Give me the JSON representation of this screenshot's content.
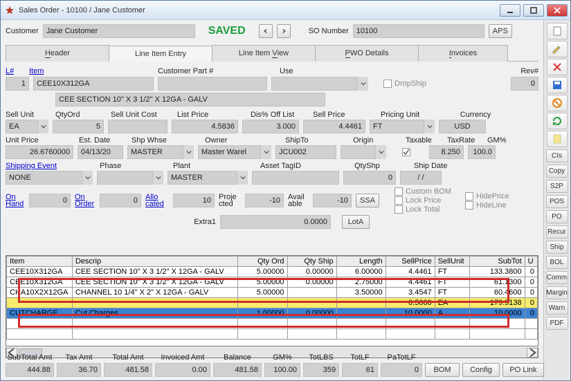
{
  "window_title": "Sales Order - 10100 / Jane Customer",
  "top": {
    "customer_label": "Customer",
    "customer_value": "Jane Customer",
    "status": "SAVED",
    "so_label": "SO Number",
    "so_value": "10100",
    "aps": "APS"
  },
  "tabs": {
    "header": "Header",
    "entry": "Line Item Entry",
    "view": "Line Item View",
    "pwo": "PWO Details",
    "invoices": "Invoices",
    "header_u": "H",
    "view_u": "V",
    "pwo_u": "P",
    "inv_u": "I"
  },
  "li": {
    "lnum_lbl": "L#",
    "item_lbl": "Item",
    "cpart_lbl": "Customer Part #",
    "use_lbl": "Use",
    "rev_lbl": "Rev#",
    "lnum": "1",
    "item": "CEE10X312GA",
    "cpart": "",
    "use": "",
    "rev": "0",
    "dropship": "DropShip",
    "desc": "CEE SECTION  10\" X 3 1/2\" X 12GA - GALV",
    "sellunit_lbl": "Sell Unit",
    "qtyord_lbl": "QtyOrd",
    "suc_lbl": "Sell Unit Cost",
    "list_lbl": "List Price",
    "disc_lbl": "Dis% Off List",
    "sellprice_lbl": "Sell Price",
    "punit_lbl": "Pricing Unit",
    "curr_lbl": "Currency",
    "sellunit": "EA",
    "qtyord": "5",
    "suc": "",
    "list": "4.5836",
    "disc": "3.000",
    "sellprice": "4.4461",
    "punit": "FT",
    "curr": "USD",
    "uprice_lbl": "Unit Price",
    "edate_lbl": "Est. Date",
    "whse_lbl": "Shp Whse",
    "owner_lbl": "Owner",
    "shipto_lbl": "ShipTo",
    "origin_lbl": "Origin",
    "tax_lbl": "Taxable",
    "rate_lbl": "TaxRate",
    "gm_lbl": "GM%",
    "uprice": "26.6760000",
    "edate": "04/13/20",
    "whse": "MASTER",
    "owner": "Master Warel",
    "shipto": "JCU002",
    "origin": "",
    "rate": "8.250",
    "gm": "100.0",
    "shevent_lbl": "Shipping Event",
    "phase_lbl": "Phase",
    "plant_lbl": "Plant",
    "asset_lbl": "Asset TagID",
    "qtyshp_lbl": "QtyShp",
    "shipdate_lbl": "Ship Date",
    "shevent": "NONE",
    "phase": "",
    "plant": "MASTER",
    "asset": "",
    "qtyshp": "0",
    "shipdate": "/  /",
    "onhand_lbl": "On Hand",
    "onhand": "0",
    "onorder_lbl": "On Order",
    "onorder": "0",
    "alloc_lbl": "Allo cated",
    "alloc": "10",
    "proj_lbl": "Proje cted",
    "proj": "-10",
    "avail_lbl": "Avail able",
    "avail": "-10",
    "ssa": "SSA",
    "custombom": "Custom BOM",
    "hideprice": "HidePrice",
    "lockprice": "Lock Price",
    "hideline": "HideLine",
    "locktotal": "Lock Total",
    "extra_lbl": "Extra1",
    "extra": "0.0000",
    "lota": "LotA"
  },
  "table": {
    "cols": {
      "item": "Item",
      "desc": "Descrip",
      "qord": "Qty Ord",
      "qship": "Qty Ship",
      "len": "Length",
      "sp": "SellPrice",
      "su": "SellUnit",
      "sub": "SubTot",
      "u": "U"
    },
    "rows": [
      {
        "item": "CEE10X312GA",
        "desc": "CEE SECTION  10\" X 3 1/2\" X 12GA - GALV",
        "qord": "5.00000",
        "qship": "0.00000",
        "len": "6.00000",
        "sp": "4.4461",
        "su": "FT",
        "sub": "133.3800",
        "u": "0"
      },
      {
        "item": "CEE10X312GA",
        "desc": "CEE SECTION  10\" X 3 1/2\" X 12GA - GALV",
        "qord": "5.00000",
        "qship": "0.00000",
        "len": "2.75000",
        "sp": "4.4461",
        "su": "FT",
        "sub": "61.1300",
        "u": "0"
      },
      {
        "item": "CHA10X2X12GA",
        "desc": "CHANNEL  10 1/4\" X 2\" X 12GA - GALV",
        "qord": "5.00000",
        "qship": "",
        "len": "3.50000",
        "sp": "3.4547",
        "su": "FT",
        "sub": "60.4600",
        "u": "0"
      },
      {
        "item": "",
        "desc": "",
        "qord": "",
        "qship": "",
        "len": "",
        "sp": "0.5000",
        "su": "EA",
        "sub": "179.9138",
        "u": "0"
      },
      {
        "item": "CUTCHARGE",
        "desc": "Cut Charges",
        "qord": "1.00000",
        "qship": "0.00000",
        "len": "",
        "sp": "10.0000",
        "su": "A",
        "sub": "10.0000",
        "u": "0"
      }
    ]
  },
  "totals": {
    "lbls": {
      "sub": "SubTotal Amt",
      "tax": "Tax Amt",
      "tot": "Total Amt",
      "inv": "Invoiced Amt",
      "bal": "Balance",
      "gm": "GM%",
      "lbs": "TotLBS",
      "lf": "TotLF",
      "palf": "PaTotLF"
    },
    "vals": {
      "sub": "444.88",
      "tax": "36.70",
      "tot": "481.58",
      "inv": "0.00",
      "bal": "481.58",
      "gm": "100.00",
      "lbs": "359",
      "lf": "61",
      "palf": "0"
    },
    "btns": {
      "bom": "BOM",
      "config": "Config",
      "polink": "PO Link"
    }
  },
  "sidebar": [
    "CIs",
    "Copy",
    "S2P",
    "POS",
    "PO",
    "Recur",
    "Ship",
    "BOL",
    "Comm",
    "Margin",
    "Warn",
    "PDF"
  ]
}
